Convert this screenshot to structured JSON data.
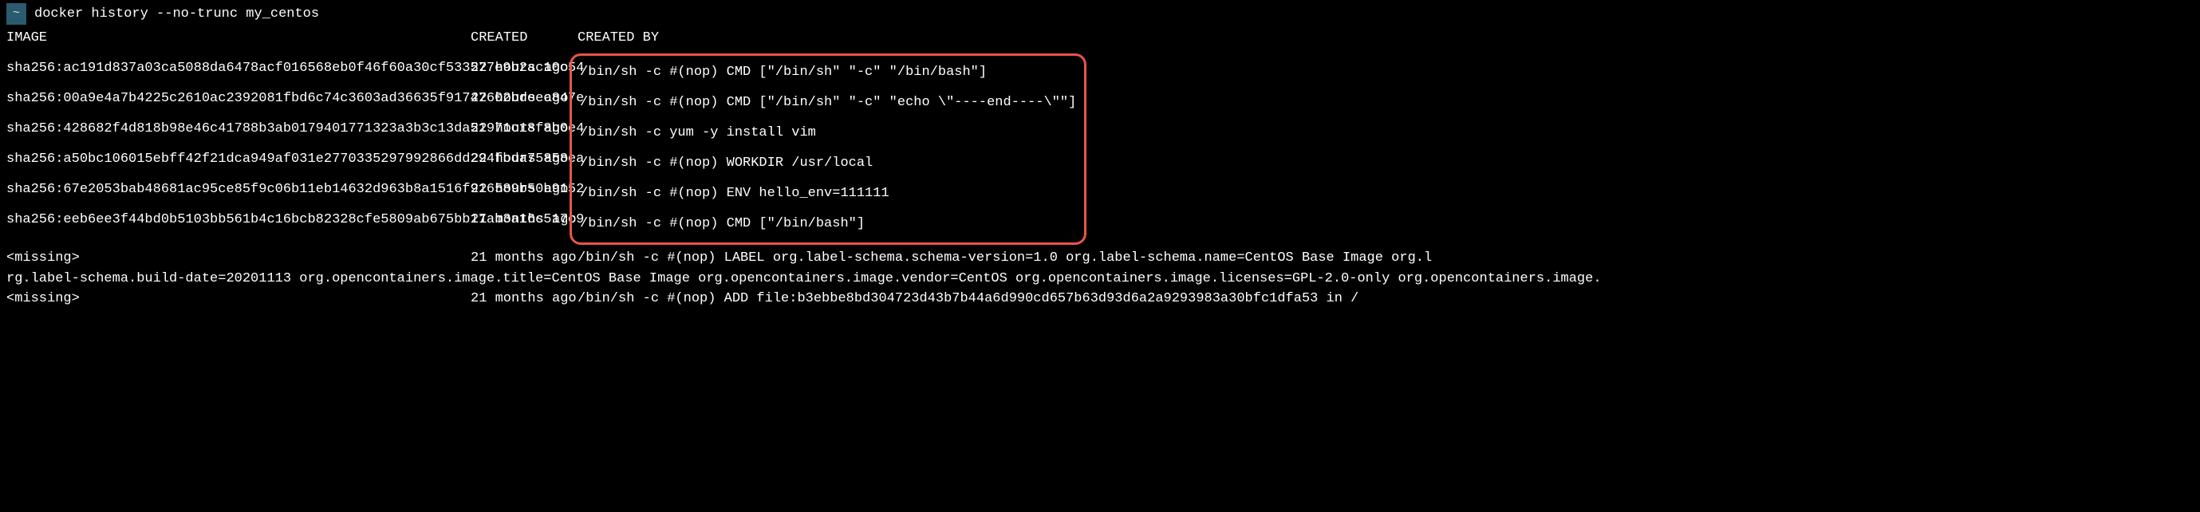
{
  "prompt": {
    "symbol": "~",
    "command": "docker history --no-trunc my_centos"
  },
  "headers": {
    "image": "IMAGE",
    "created": "CREATED",
    "created_by": "CREATED BY"
  },
  "rows": [
    {
      "image": "sha256:ac191d837a03ca5088da6478acf016568eb0f46f60a30cf533577e9b2ac10c54",
      "created": "22 hours ago",
      "created_by": "/bin/sh -c #(nop)  CMD [\"/bin/sh\" \"-c\" \"/bin/bash\"]"
    },
    {
      "image": "sha256:00a9e4a7b4225c2610ac2392081fbd6c74c3603ad36635f91747602bdeec847e",
      "created": "22 hours ago",
      "created_by": "/bin/sh -c #(nop)  CMD [\"/bin/sh\" \"-c\" \"echo \\\"----end----\\\"\"]"
    },
    {
      "image": "sha256:428682f4d818b98e46c41788b3ab0179401771323a3b3c13da51971c18f8b0e4",
      "created": "22 hours ago",
      "created_by": "/bin/sh -c yum -y install vim"
    },
    {
      "image": "sha256:a50bc106015ebff42f21dca949af031e2770335297992866dd294fbda75858ea",
      "created": "22 hours ago",
      "created_by": "/bin/sh -c #(nop) WORKDIR /usr/local"
    },
    {
      "image": "sha256:67e2053bab48681ac95ce85f9c06b11eb14632d963b8a1516f916589b50b9152",
      "created": "22 hours ago",
      "created_by": "/bin/sh -c #(nop)  ENV hello_env=111111"
    },
    {
      "image": "sha256:eeb6ee3f44bd0b5103bb561b4c16bcb82328cfe5809ab675bb17ab3a16c517c9",
      "created": "21 months ago",
      "created_by": "/bin/sh -c #(nop)  CMD [\"/bin/bash\"]"
    }
  ],
  "extra_rows": [
    {
      "image": "<missing>",
      "created": "21 months ago",
      "created_by": "/bin/sh -c #(nop)  LABEL org.label-schema.schema-version=1.0 org.label-schema.name=CentOS Base Image org.l"
    }
  ],
  "wrap_line": "rg.label-schema.build-date=20201113 org.opencontainers.image.title=CentOS Base Image org.opencontainers.image.vendor=CentOS org.opencontainers.image.licenses=GPL-2.0-only org.opencontainers.image.",
  "last_row": {
    "image": "<missing>",
    "created": "21 months ago",
    "created_by": "/bin/sh -c #(nop) ADD file:b3ebbe8bd304723d43b7b44a6d990cd657b63d93d6a2a9293983a30bfc1dfa53 in /"
  }
}
